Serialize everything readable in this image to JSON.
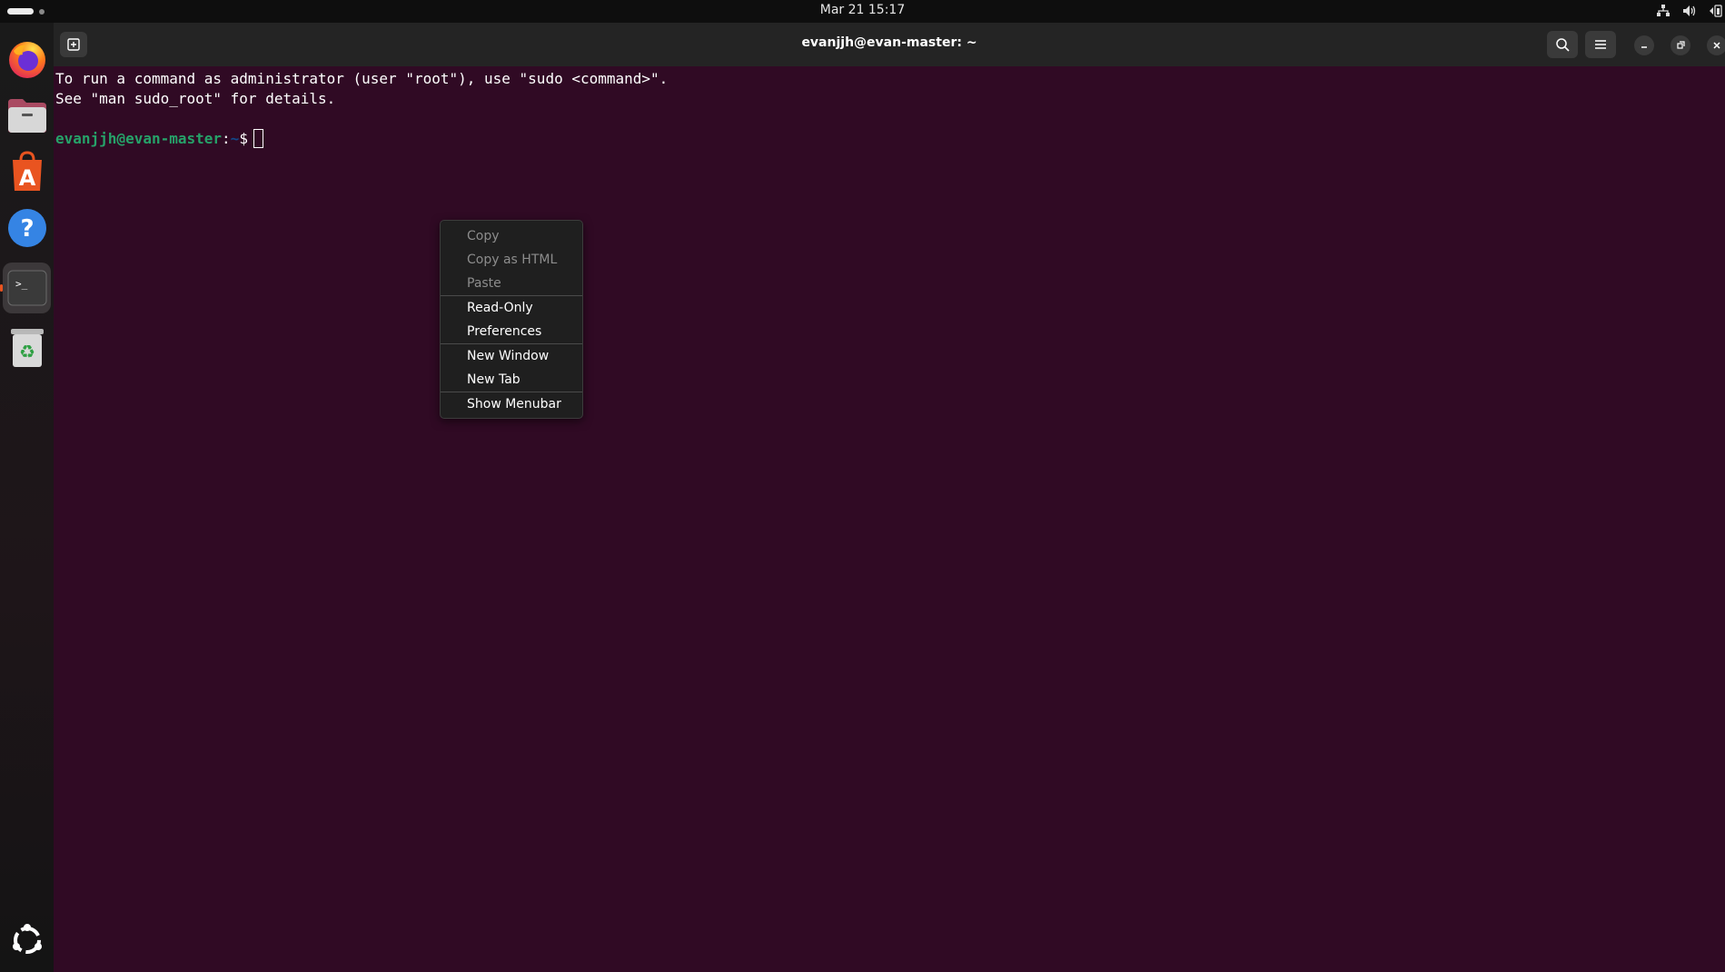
{
  "topbar": {
    "clock": "Mar 21  15:17",
    "icons": [
      "network-icon",
      "volume-icon",
      "battery-icon"
    ]
  },
  "dock": {
    "items": [
      {
        "name": "firefox",
        "icon": "firefox-icon"
      },
      {
        "name": "files",
        "icon": "files-icon"
      },
      {
        "name": "app-center",
        "icon": "app-center-icon"
      },
      {
        "name": "help",
        "icon": "help-icon"
      },
      {
        "name": "terminal",
        "icon": "terminal-icon",
        "active": true
      },
      {
        "name": "trash",
        "icon": "trash-icon"
      },
      {
        "name": "show-apps",
        "icon": "ubuntu-logo-icon"
      }
    ]
  },
  "window": {
    "title": "evanjjh@evan-master: ~",
    "buttons": [
      "new-tab-icon",
      "search-icon",
      "hamburger-menu-icon",
      "minimize-icon",
      "restore-icon",
      "close-icon"
    ]
  },
  "terminal": {
    "lines": [
      "To run a command as administrator (user \"root\"), use \"sudo <command>\".",
      "See \"man sudo_root\" for details."
    ],
    "prompt_user": "evanjjh@evan-master",
    "prompt_sep": ":",
    "prompt_path": "~",
    "prompt_symbol": "$"
  },
  "context_menu": {
    "items": [
      {
        "label": "Copy",
        "enabled": false
      },
      {
        "label": "Copy as HTML",
        "enabled": false
      },
      {
        "label": "Paste",
        "enabled": false
      },
      {
        "label": "Read-Only",
        "enabled": true
      },
      {
        "label": "Preferences",
        "enabled": true
      },
      {
        "label": "New Window",
        "enabled": true
      },
      {
        "label": "New Tab",
        "enabled": true
      },
      {
        "label": "Show Menubar",
        "enabled": true
      }
    ]
  },
  "colors": {
    "terminal_bg": "#300a24",
    "prompt_user": "#26a269",
    "prompt_path": "#12488b",
    "accent": "#e95420"
  }
}
